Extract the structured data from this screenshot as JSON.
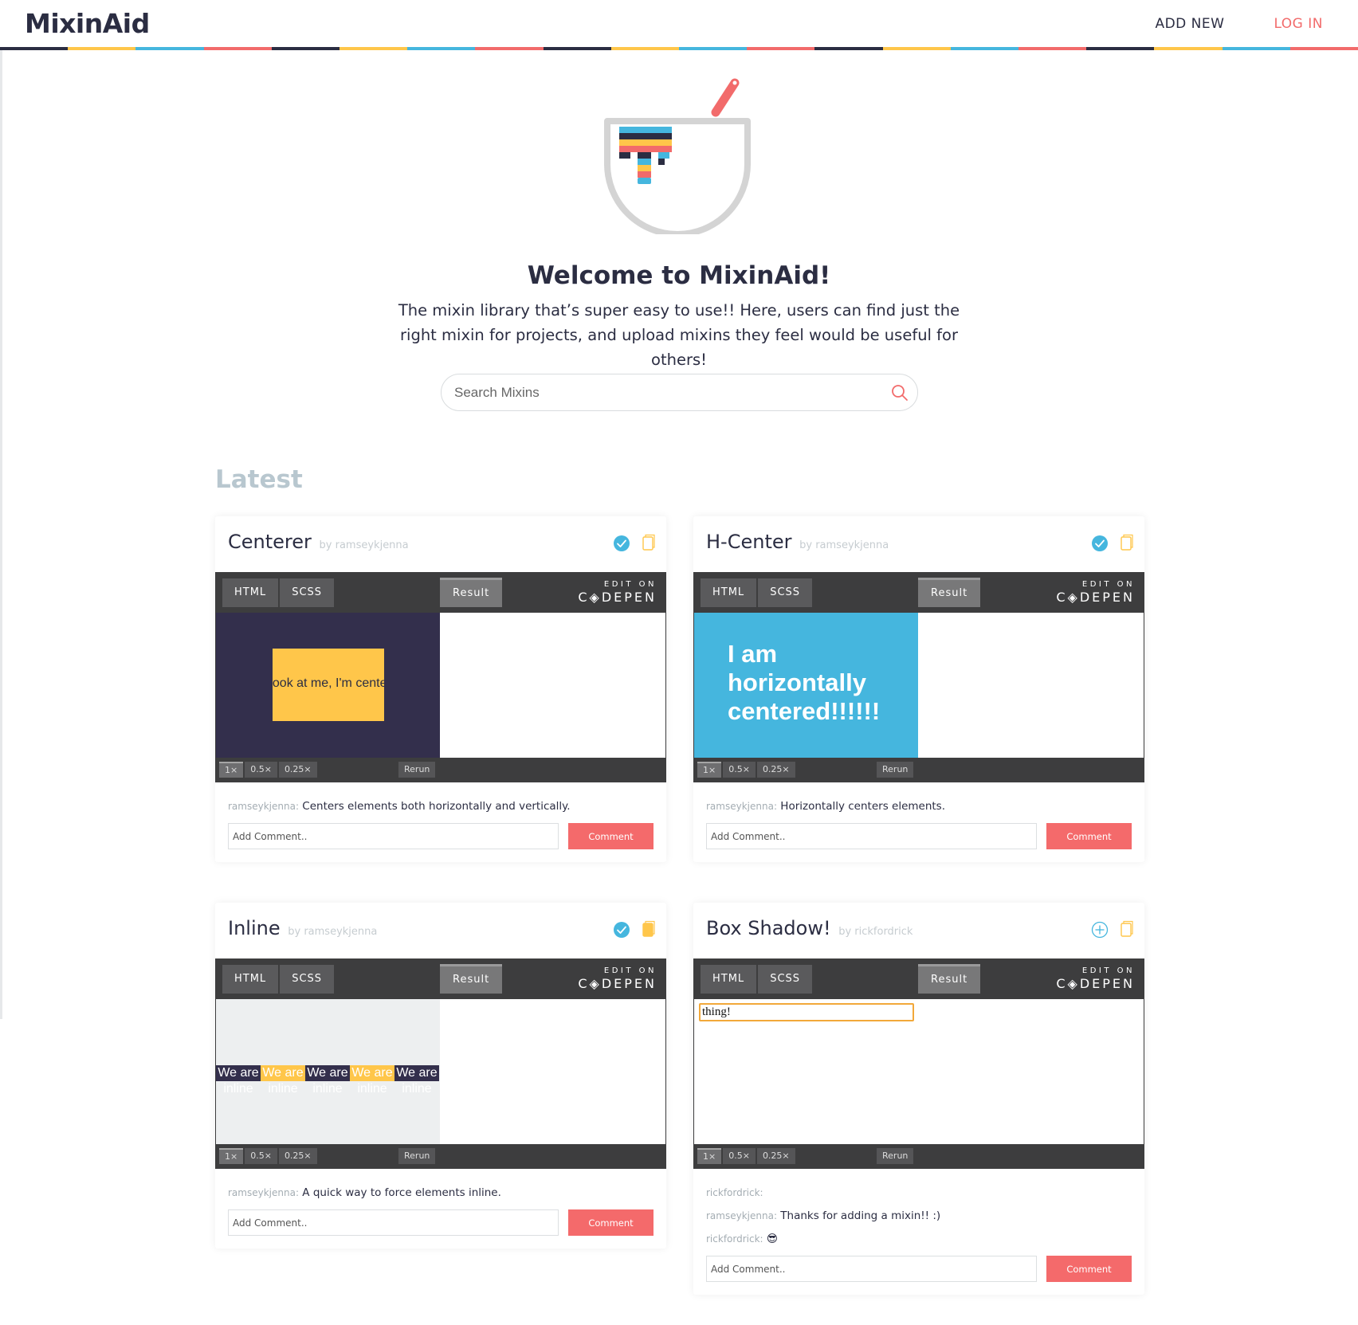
{
  "header": {
    "logo": "MixinAid",
    "nav_add": "ADD NEW",
    "nav_login": "LOG IN",
    "stripe_colors": [
      "#2b2d42",
      "#ffc64a",
      "#45b6de",
      "#f26b6b"
    ]
  },
  "hero": {
    "title": "Welcome to MixinAid!",
    "subtitle": "The mixin library that’s super easy to use!! Here, users can find just the right mixin for projects, and upload mixins they feel would be useful for others!",
    "search_placeholder": "Search Mixins"
  },
  "section_title": "Latest",
  "codepen": {
    "tab_html": "HTML",
    "tab_scss": "SCSS",
    "tab_result": "Result",
    "edit_on": "EDIT ON",
    "brand": "C◈DEPEN",
    "zoom": [
      "1×",
      "0.5×",
      "0.25×"
    ],
    "rerun": "Rerun"
  },
  "comment_placeholder": "Add Comment..",
  "comment_button": "Comment",
  "cards": [
    {
      "title": "Centerer",
      "by": "by ramseykjenna",
      "saved": true,
      "preview_text": "Look at me, I'm centered!",
      "comments": [
        {
          "user": "ramseykjenna:",
          "text": "Centers elements both horizontally and vertically."
        }
      ]
    },
    {
      "title": "H-Center",
      "by": "by ramseykjenna",
      "saved": true,
      "preview_text": "I am horizontally centered!!!!!!",
      "comments": [
        {
          "user": "ramseykjenna:",
          "text": "Horizontally centers elements."
        }
      ]
    },
    {
      "title": "Inline",
      "by": "by ramseykjenna",
      "saved": true,
      "preview_top": "We are",
      "preview_bottom": "inline",
      "comments": [
        {
          "user": "ramseykjenna:",
          "text": "A quick way to force elements inline."
        }
      ]
    },
    {
      "title": "Box Shadow!",
      "by": "by rickfordrick",
      "saved": false,
      "preview_text": "thing!",
      "comments": [
        {
          "user": "rickfordrick:",
          "text": ""
        },
        {
          "user": "ramseykjenna:",
          "text": "Thanks for adding a mixin!! :)"
        },
        {
          "user": "rickfordrick:",
          "text": "😎"
        }
      ]
    }
  ]
}
